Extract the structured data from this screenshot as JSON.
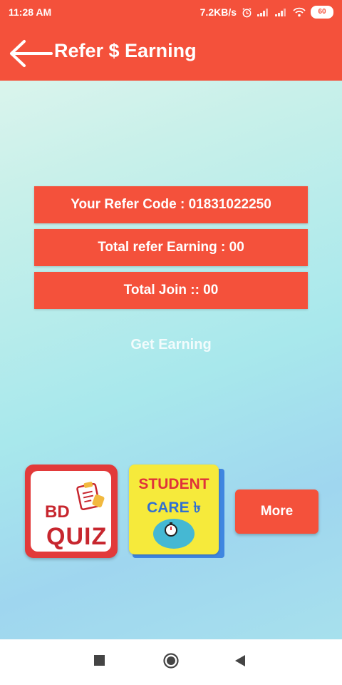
{
  "status_bar": {
    "time": "11:28 AM",
    "speed": "7.2KB/s",
    "battery": "60"
  },
  "header": {
    "title": "Refer $ Earning"
  },
  "info": {
    "refer_code": "Your Refer Code :  01831022250",
    "total_earning": "Total refer Earning : 00",
    "total_join": "Total Join :: 00"
  },
  "get_earning_label": "Get Earning",
  "apps": {
    "quiz": {
      "line1": "BD",
      "line2": "QUIZ"
    },
    "student": {
      "line1": "STUDENT",
      "line2": "CARE ৳"
    }
  },
  "more_label": "More",
  "icons": {
    "back": "arrow-left-icon",
    "alarm": "alarm-icon",
    "signal": "signal-icon",
    "wifi": "wifi-icon",
    "battery": "battery-icon",
    "nav_recent": "square-icon",
    "nav_home": "circle-icon",
    "nav_back": "triangle-back-icon"
  },
  "colors": {
    "accent": "#f4513b"
  }
}
